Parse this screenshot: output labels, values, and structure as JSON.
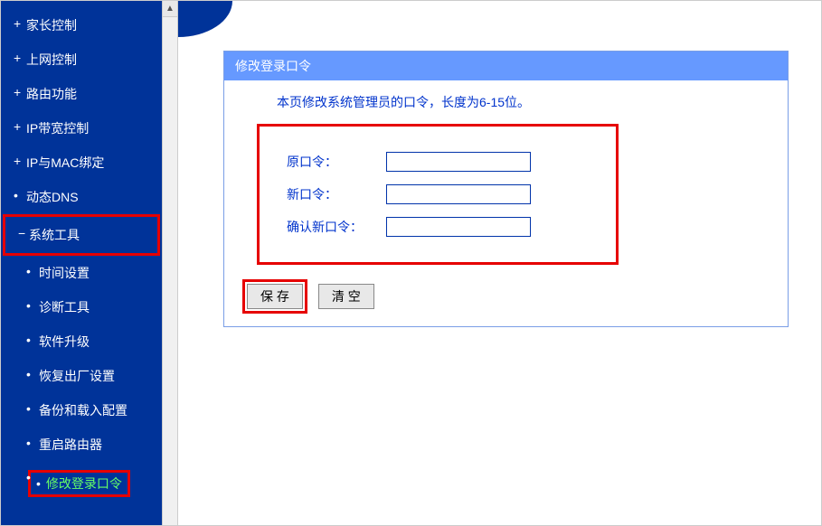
{
  "sidebar": {
    "items": [
      {
        "label": "家长控制",
        "type": "top"
      },
      {
        "label": "上网控制",
        "type": "top"
      },
      {
        "label": "路由功能",
        "type": "top"
      },
      {
        "label": "IP带宽控制",
        "type": "top"
      },
      {
        "label": "IP与MAC绑定",
        "type": "top"
      },
      {
        "label": "动态DNS",
        "type": "bullet"
      },
      {
        "label": "系统工具",
        "type": "expanded",
        "highlight": true
      },
      {
        "label": "时间设置",
        "type": "sub"
      },
      {
        "label": "诊断工具",
        "type": "sub"
      },
      {
        "label": "软件升级",
        "type": "sub"
      },
      {
        "label": "恢复出厂设置",
        "type": "sub"
      },
      {
        "label": "备份和载入配置",
        "type": "sub"
      },
      {
        "label": "重启路由器",
        "type": "sub"
      },
      {
        "label": "修改登录口令",
        "type": "sub",
        "active": true,
        "highlight": true
      }
    ]
  },
  "panel": {
    "title": "修改登录口令",
    "instruction": "本页修改系统管理员的口令，长度为6-15位。",
    "fields": {
      "old_label": "原口令：",
      "new_label": "新口令：",
      "confirm_label": "确认新口令："
    },
    "buttons": {
      "save": "保 存",
      "clear": "清 空"
    }
  }
}
